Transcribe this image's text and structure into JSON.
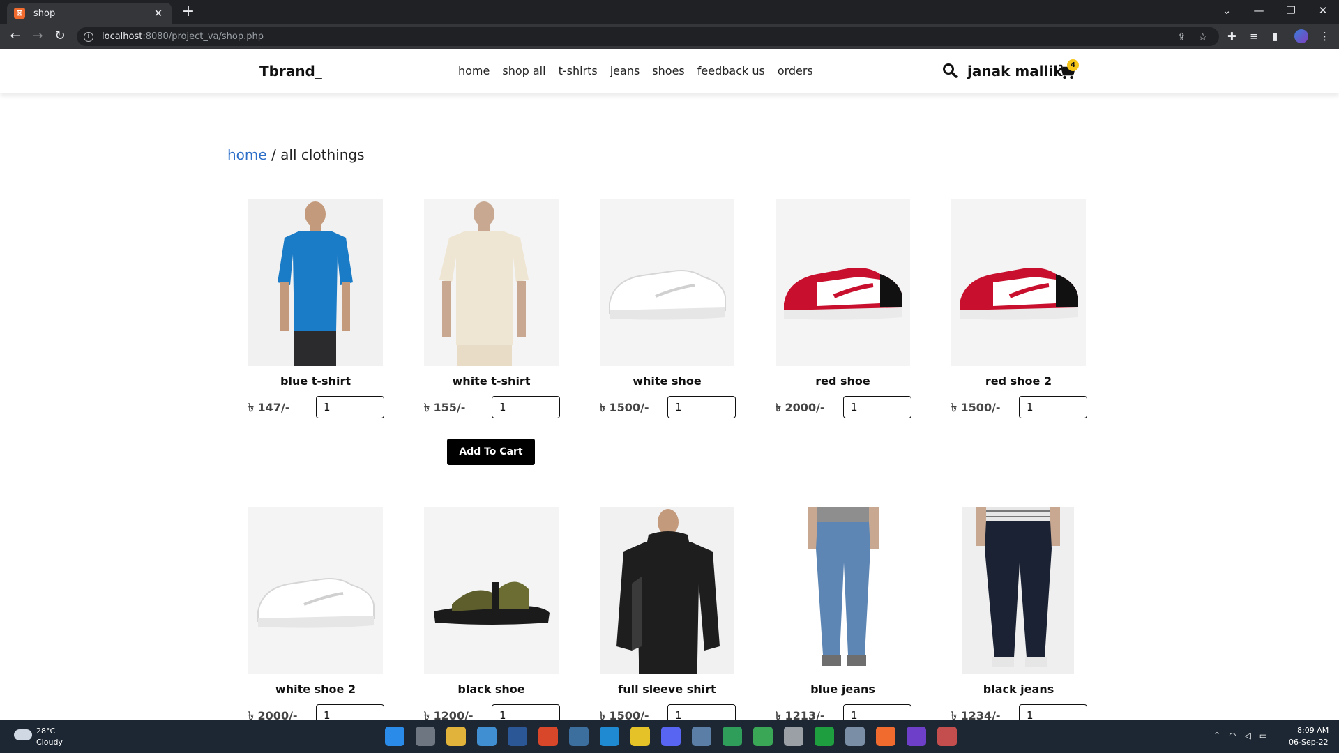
{
  "browser": {
    "tab_title": "shop",
    "tab_favicon": "xampp-icon",
    "url_host": "localhost",
    "url_path": ":8080/project_va/shop.php"
  },
  "site": {
    "brand": "Tbrand_",
    "nav": [
      "home",
      "shop all",
      "t-shirts",
      "jeans",
      "shoes",
      "feedback us",
      "orders"
    ],
    "username": "janak mallik",
    "cart_count": "4"
  },
  "breadcrumb": {
    "link": "home",
    "separator": " / ",
    "current": "all clothings"
  },
  "products": [
    {
      "name": "blue t-shirt",
      "price": "৳ 147/-",
      "qty": "1",
      "image": "blue-tshirt-model"
    },
    {
      "name": "white t-shirt",
      "price": "৳ 155/-",
      "qty": "1",
      "image": "white-tshirt-model"
    },
    {
      "name": "white shoe",
      "price": "৳ 1500/-",
      "qty": "1",
      "image": "white-sneaker"
    },
    {
      "name": "red shoe",
      "price": "৳ 2000/-",
      "qty": "1",
      "image": "red-sneaker"
    },
    {
      "name": "red shoe 2",
      "price": "৳ 1500/-",
      "qty": "1",
      "image": "red-sneaker"
    },
    {
      "name": "white shoe 2",
      "price": "৳ 2000/-",
      "qty": "1",
      "image": "white-sneaker"
    },
    {
      "name": "black shoe",
      "price": "৳ 1200/-",
      "qty": "1",
      "image": "olive-sandal"
    },
    {
      "name": "full sleeve shirt",
      "price": "৳ 1500/-",
      "qty": "1",
      "image": "black-hoodie-model"
    },
    {
      "name": "blue jeans",
      "price": "৳ 1213/-",
      "qty": "1",
      "image": "blue-jeans-model"
    },
    {
      "name": "black jeans",
      "price": "৳ 1234/-",
      "qty": "1",
      "image": "black-jeans-model"
    }
  ],
  "add_to_cart_label": "Add To Cart",
  "taskbar": {
    "temp": "28°C",
    "condition": "Cloudy",
    "time": "8:09 AM",
    "date": "06-Sep-22"
  },
  "colors": {
    "link": "#2c6fc9",
    "cart_badge": "#f5c518",
    "button": "#000000"
  }
}
